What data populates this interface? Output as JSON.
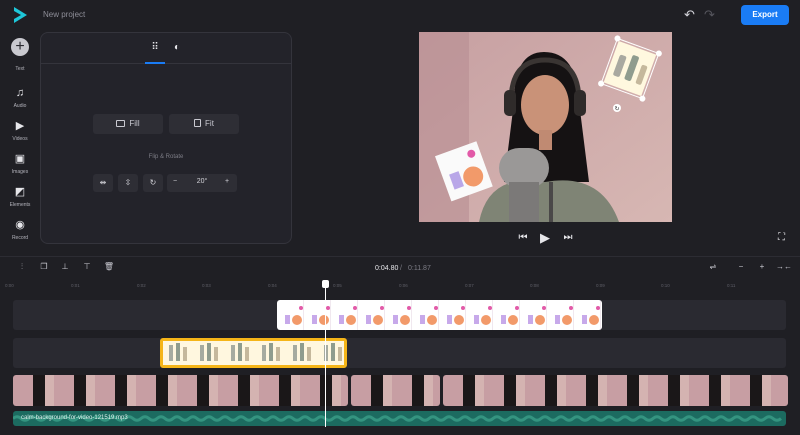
{
  "header": {
    "title": "New project",
    "export_label": "Export"
  },
  "sidebar": {
    "items": [
      {
        "label": "Text",
        "icon": "plus-icon"
      },
      {
        "label": "Audio",
        "icon": "music-icon"
      },
      {
        "label": "Videos",
        "icon": "video-icon"
      },
      {
        "label": "Images",
        "icon": "image-icon"
      },
      {
        "label": "Elements",
        "icon": "elements-icon"
      },
      {
        "label": "Record",
        "icon": "record-icon"
      }
    ]
  },
  "panel": {
    "fill_label": "Fill",
    "fit_label": "Fit",
    "flip_rotate_label": "Flip & Rotate",
    "angle_value": "20°",
    "minus": "−",
    "plus": "+"
  },
  "timeline": {
    "current_time": "0:04.80",
    "separator": "/",
    "total_time": "0:11.87",
    "ruler": [
      "0:00",
      "0:01",
      "0:02",
      "0:03",
      "0:04",
      "0:05",
      "0:06",
      "0:07",
      "0:08",
      "0:09",
      "0:10",
      "0:11"
    ],
    "audio_label": "calm-background-for-video-121519.mp3"
  },
  "colors": {
    "accent": "#1a7cf5",
    "audio": "#1c6b60",
    "selection": "#f5b518"
  }
}
